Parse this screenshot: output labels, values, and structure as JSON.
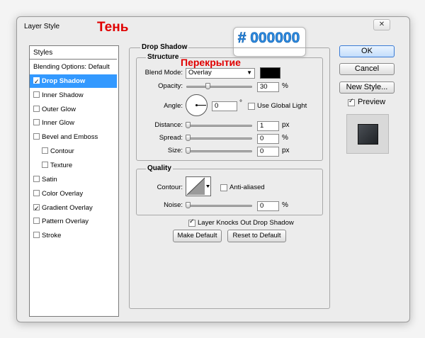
{
  "window": {
    "title": "Layer Style",
    "close_symbol": "✕"
  },
  "annotations": {
    "shadow_ru": "Тень",
    "overlay_ru": "Перекрытие",
    "color_hex": "# 000000"
  },
  "styles_panel": {
    "header": "Styles",
    "items": [
      {
        "label": "Blending Options: Default",
        "checkbox": false,
        "checked": false,
        "indent": false,
        "selected": false
      },
      {
        "label": "Drop Shadow",
        "checkbox": true,
        "checked": true,
        "indent": false,
        "selected": true
      },
      {
        "label": "Inner Shadow",
        "checkbox": true,
        "checked": false,
        "indent": false,
        "selected": false
      },
      {
        "label": "Outer Glow",
        "checkbox": true,
        "checked": false,
        "indent": false,
        "selected": false
      },
      {
        "label": "Inner Glow",
        "checkbox": true,
        "checked": false,
        "indent": false,
        "selected": false
      },
      {
        "label": "Bevel and Emboss",
        "checkbox": true,
        "checked": false,
        "indent": false,
        "selected": false
      },
      {
        "label": "Contour",
        "checkbox": true,
        "checked": false,
        "indent": true,
        "selected": false
      },
      {
        "label": "Texture",
        "checkbox": true,
        "checked": false,
        "indent": true,
        "selected": false
      },
      {
        "label": "Satin",
        "checkbox": true,
        "checked": false,
        "indent": false,
        "selected": false
      },
      {
        "label": "Color Overlay",
        "checkbox": true,
        "checked": false,
        "indent": false,
        "selected": false
      },
      {
        "label": "Gradient Overlay",
        "checkbox": true,
        "checked": true,
        "indent": false,
        "selected": false
      },
      {
        "label": "Pattern Overlay",
        "checkbox": true,
        "checked": false,
        "indent": false,
        "selected": false
      },
      {
        "label": "Stroke",
        "checkbox": true,
        "checked": false,
        "indent": false,
        "selected": false
      }
    ]
  },
  "drop_shadow": {
    "title": "Drop Shadow",
    "structure": {
      "title": "Structure",
      "blend_mode_label": "Blend Mode:",
      "blend_mode_value": "Overlay",
      "shadow_color": "#000000",
      "opacity_label": "Opacity:",
      "opacity_value": "30",
      "opacity_fraction": 0.3,
      "angle_label": "Angle:",
      "angle_value": "0",
      "degree_symbol": "°",
      "global_light_label": "Use Global Light",
      "global_light_checked": false,
      "distance_label": "Distance:",
      "distance_value": "1",
      "spread_label": "Spread:",
      "spread_value": "0",
      "size_label": "Size:",
      "size_value": "0",
      "percent_unit": "%",
      "px_unit": "px"
    },
    "quality": {
      "title": "Quality",
      "contour_label": "Contour:",
      "anti_aliased_label": "Anti-aliased",
      "anti_aliased_checked": false,
      "noise_label": "Noise:",
      "noise_value": "0",
      "percent_unit": "%"
    },
    "knocks_out_label": "Layer Knocks Out Drop Shadow",
    "knocks_out_checked": true,
    "make_default": "Make Default",
    "reset_default": "Reset to Default"
  },
  "buttons": {
    "ok": "OK",
    "cancel": "Cancel",
    "new_style": "New Style...",
    "preview": "Preview",
    "preview_checked": true
  },
  "colors": {
    "accent": "#3399ff",
    "annotation_red": "#e00000",
    "hex_blue": "#2e8be0"
  }
}
